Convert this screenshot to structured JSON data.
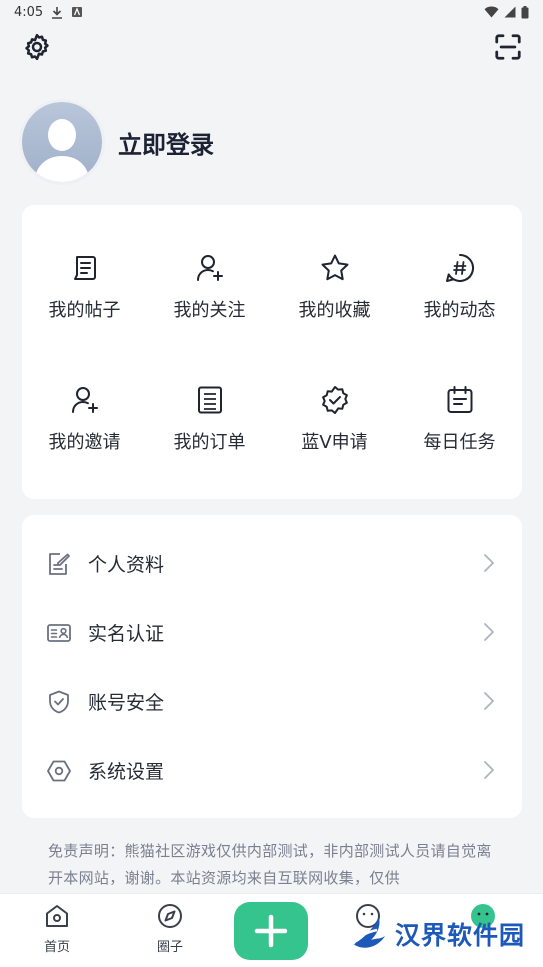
{
  "status_bar": {
    "time": "4:05"
  },
  "profile": {
    "login_label": "立即登录"
  },
  "grid": {
    "items": [
      {
        "label": "我的帖子",
        "icon": "post-icon"
      },
      {
        "label": "我的关注",
        "icon": "user-add-icon"
      },
      {
        "label": "我的收藏",
        "icon": "star-icon"
      },
      {
        "label": "我的动态",
        "icon": "hashtag-icon"
      },
      {
        "label": "我的邀请",
        "icon": "invite-icon"
      },
      {
        "label": "我的订单",
        "icon": "order-icon"
      },
      {
        "label": "蓝V申请",
        "icon": "verified-badge-icon"
      },
      {
        "label": "每日任务",
        "icon": "calendar-icon"
      }
    ]
  },
  "list": {
    "items": [
      {
        "label": "个人资料",
        "icon": "edit-profile-icon"
      },
      {
        "label": "实名认证",
        "icon": "id-card-icon"
      },
      {
        "label": "账号安全",
        "icon": "shield-icon"
      },
      {
        "label": "系统设置",
        "icon": "hexagon-settings-icon"
      }
    ]
  },
  "disclaimer": "免责声明：熊猫社区游戏仅供内部测试，非内部测试人员请自觉离开本网站，谢谢。本站资源均来自互联网收集，仅供",
  "bottom_nav": {
    "home_label": "首页",
    "circle_label": "圈子"
  },
  "watermark": {
    "text": "汉界软件园"
  },
  "colors": {
    "accent": "#36c48e",
    "background": "#f3f4f6",
    "watermark": "#1d59b8"
  }
}
